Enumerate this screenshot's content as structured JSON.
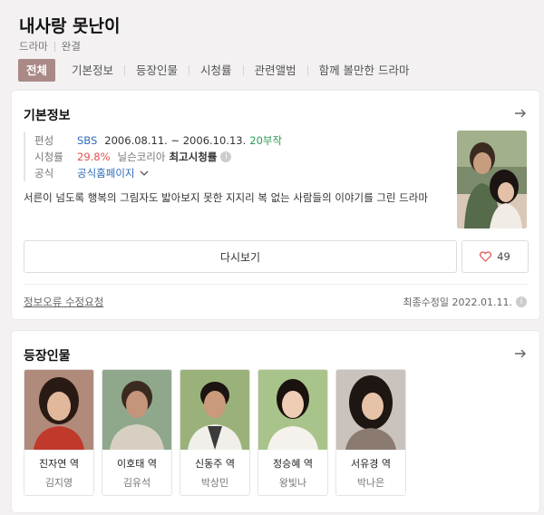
{
  "header": {
    "title": "내사랑 못난이",
    "genre": "드라마",
    "status": "완결",
    "tabs": [
      "전체",
      "기본정보",
      "등장인물",
      "시청률",
      "관련앨범",
      "함께 볼만한 드라마"
    ]
  },
  "basic_info": {
    "title": "기본정보",
    "arrow_icon": "arrow-right-icon",
    "broadcast_label": "편성",
    "broadcaster": "SBS",
    "dates": "2006.08.11. ~ 2006.10.13.",
    "episodes": "20부작",
    "rating_label": "시청률",
    "rating_value": "29.8%",
    "rating_source": "닐슨코리아",
    "rating_note": "최고시청률",
    "official_label": "공식",
    "official_link": "공식홈페이지",
    "description": "서른이 넘도록 행복의 그림자도 밟아보지 못한 지지리 복 없는 사람들의 이야기를 그린 드라마",
    "watch_label": "다시보기",
    "like_count": "49",
    "report_label": "정보오류 수정요청",
    "modified": "최종수정일 2022.01.11."
  },
  "cast": {
    "title": "등장인물",
    "members": [
      {
        "role": "진자연 역",
        "actor": "김지영"
      },
      {
        "role": "이호태 역",
        "actor": "김유석"
      },
      {
        "role": "신동주 역",
        "actor": "박상민"
      },
      {
        "role": "정승혜 역",
        "actor": "왕빛나"
      },
      {
        "role": "서유경 역",
        "actor": "박나은"
      }
    ]
  },
  "colors": {
    "active_tab": "#a98a87",
    "episodes": "#2b9d57",
    "rating": "#e0524d",
    "link": "#2f6bb8"
  }
}
